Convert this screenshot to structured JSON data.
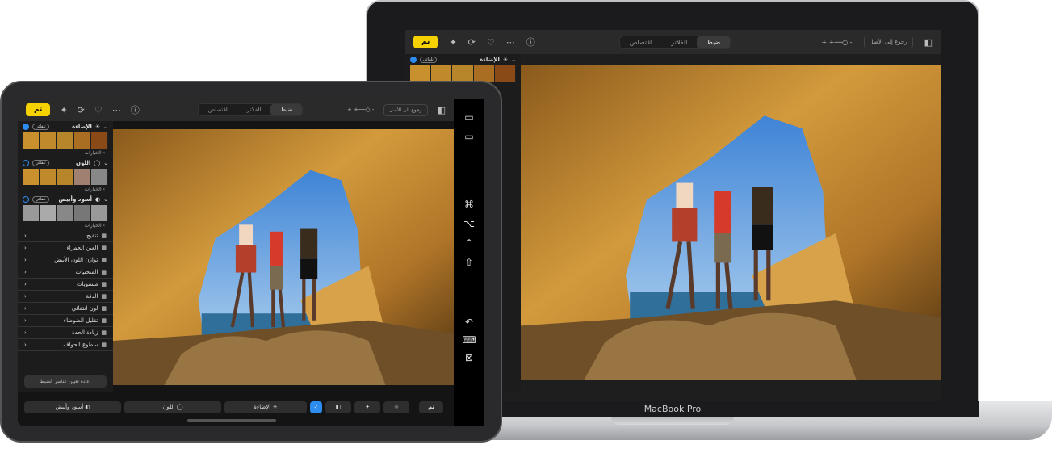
{
  "app": {
    "done": "تم",
    "tabs": [
      "ضبط",
      "الفلاتر",
      "اقتصاص"
    ],
    "revert": "رجوع إلى الأصل",
    "sections": [
      {
        "title": "الإضاءة",
        "badge": "تلقائي",
        "checked": true,
        "options": "الخيارات"
      },
      {
        "title": "اللون",
        "badge": "تلقائي",
        "checked": false,
        "options": "الخيارات"
      },
      {
        "title": "أسود وأبيض",
        "badge": "تلقائي",
        "checked": false,
        "options": "الخيارات"
      }
    ],
    "tools": [
      "تنقيح",
      "العين الحمراء",
      "توازن اللون الأبيض",
      "المنحنيات",
      "مستويات",
      "الدقة",
      "لون انتقائي",
      "تقليل الضوضاء",
      "زيادة الحدة",
      "سطوع الحواف"
    ],
    "reset": "إعادة تعيين عناصر الضبط",
    "bottom": {
      "bw": "أسود وأبيض",
      "color": "اللون",
      "light": "الإضاءة"
    }
  },
  "mac": {
    "label": "MacBook Pro"
  },
  "sidecar_icons": [
    "menu-bar-icon",
    "dock-icon",
    "command-key-icon",
    "option-key-icon",
    "control-key-icon",
    "shift-key-icon",
    "undo-icon",
    "keyboard-icon",
    "disconnect-icon"
  ],
  "colors": {
    "accent": "#f5d200",
    "blue": "#2d8cf0"
  }
}
